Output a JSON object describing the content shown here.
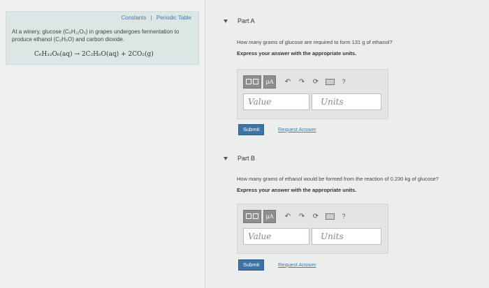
{
  "left": {
    "links": {
      "constants": "Constants",
      "separator": "|",
      "periodic_table": "Periodic Table"
    },
    "intro_text": "At a winery, glucose (C₆H₁₂O₆) in grapes undergoes fermentation to produce ethanol (C₂H₆O) and carbon dioxide.",
    "equation": "C₆H₁₂O₆(aq) → 2C₂H₆O(aq) + 2CO₂(g)"
  },
  "parts": [
    {
      "title": "Part A",
      "question": "How many grams of glucose are required to form 131 g of ethanol?",
      "instruction": "Express your answer with the appropriate units.",
      "mu_label": "μA",
      "help_label": "?",
      "value_placeholder": "Value",
      "units_placeholder": "Units",
      "submit_label": "Submit",
      "request_label": "Request Answer"
    },
    {
      "title": "Part B",
      "question": "How many grams of ethanol would be formed from the reaction of 0.230 kg of glucose?",
      "instruction": "Express your answer with the appropriate units.",
      "mu_label": "μA",
      "help_label": "?",
      "value_placeholder": "Value",
      "units_placeholder": "Units",
      "submit_label": "Submit",
      "request_label": "Request Answer"
    }
  ],
  "colors": {
    "accent": "#3d74a6",
    "link": "#3b7fb5",
    "info_bg": "#dbe6e5"
  }
}
